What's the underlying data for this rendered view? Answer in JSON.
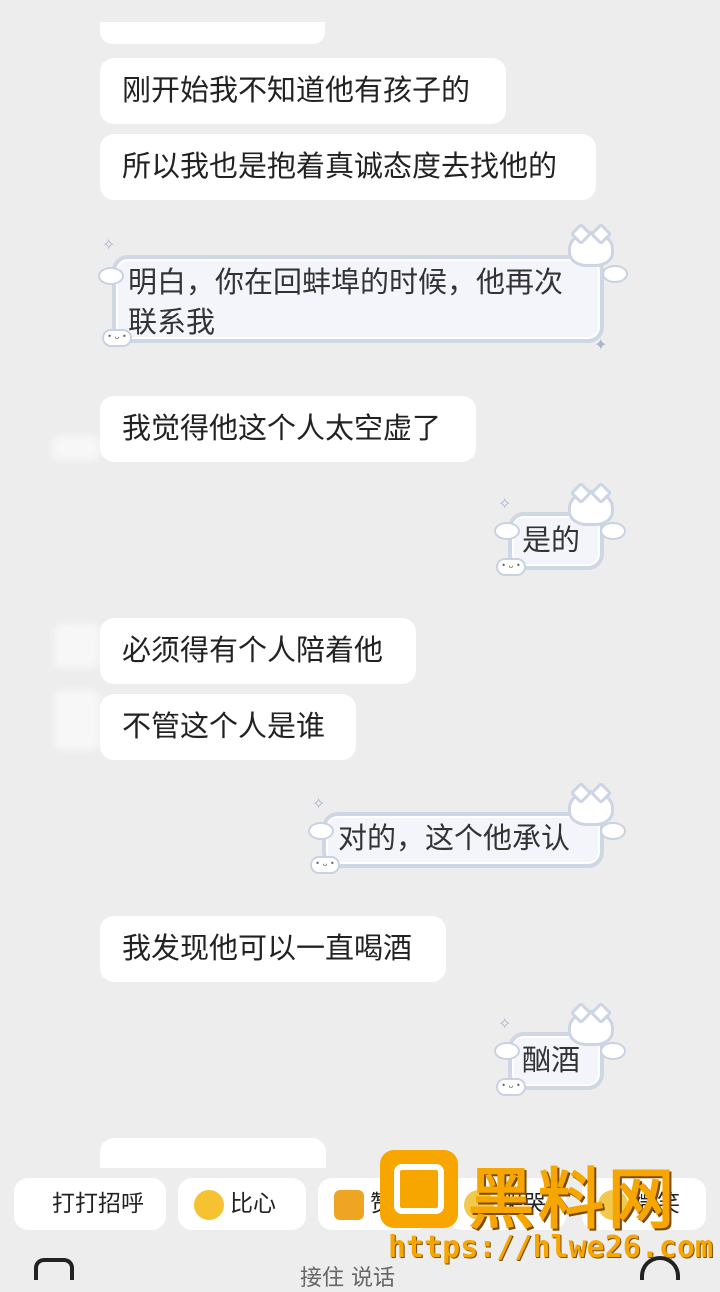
{
  "messages": {
    "m1": "刚开始我不知道他有孩子的",
    "m2": "所以我也是抱着真诚态度去找他的",
    "r1_line1": "明白，你在回蚌埠的时候，他再次",
    "r1_line2": "联系我",
    "m3": "我觉得他这个人太空虚了",
    "r2": "是的",
    "m4": "必须得有个人陪着他",
    "m5": "不管这个人是谁",
    "r3": "对的，这个他承认",
    "m6": "我发现他可以一直喝酒",
    "r4": "酗酒"
  },
  "quick_replies": {
    "greet": "打打招呼",
    "heart": "比心",
    "thumb_partial": "赞",
    "cry_partial": "哭哭",
    "smile_partial": "微笑"
  },
  "input": {
    "placeholder_partial": "接住 说话"
  },
  "watermark": {
    "title": "黑料网",
    "url": "https://hlwe26.com"
  },
  "colors": {
    "background": "#ededed",
    "bubble": "#ffffff",
    "watermark": "#f7a600"
  }
}
